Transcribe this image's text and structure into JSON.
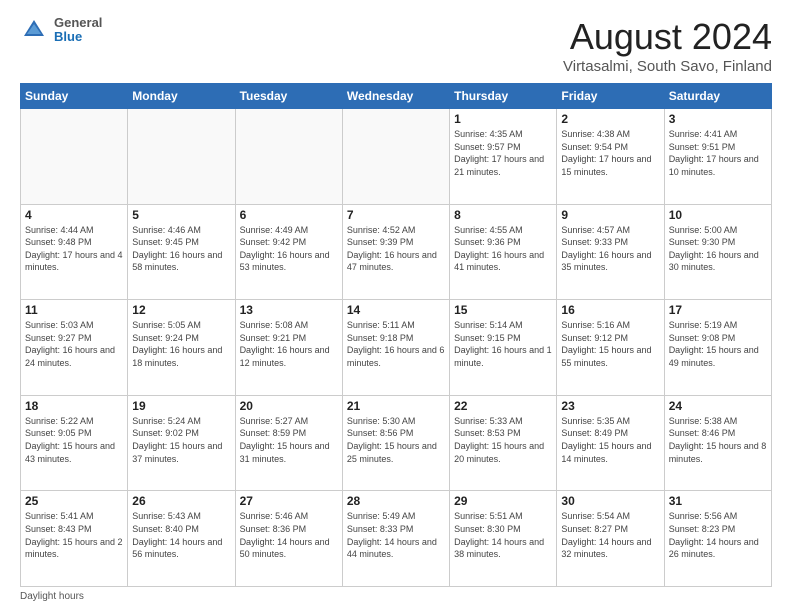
{
  "header": {
    "logo_line1": "General",
    "logo_line2": "Blue",
    "title": "August 2024",
    "subtitle": "Virtasalmi, South Savo, Finland"
  },
  "calendar": {
    "days_of_week": [
      "Sunday",
      "Monday",
      "Tuesday",
      "Wednesday",
      "Thursday",
      "Friday",
      "Saturday"
    ],
    "weeks": [
      [
        {
          "day": "",
          "info": ""
        },
        {
          "day": "",
          "info": ""
        },
        {
          "day": "",
          "info": ""
        },
        {
          "day": "",
          "info": ""
        },
        {
          "day": "1",
          "info": "Sunrise: 4:35 AM\nSunset: 9:57 PM\nDaylight: 17 hours\nand 21 minutes."
        },
        {
          "day": "2",
          "info": "Sunrise: 4:38 AM\nSunset: 9:54 PM\nDaylight: 17 hours\nand 15 minutes."
        },
        {
          "day": "3",
          "info": "Sunrise: 4:41 AM\nSunset: 9:51 PM\nDaylight: 17 hours\nand 10 minutes."
        }
      ],
      [
        {
          "day": "4",
          "info": "Sunrise: 4:44 AM\nSunset: 9:48 PM\nDaylight: 17 hours\nand 4 minutes."
        },
        {
          "day": "5",
          "info": "Sunrise: 4:46 AM\nSunset: 9:45 PM\nDaylight: 16 hours\nand 58 minutes."
        },
        {
          "day": "6",
          "info": "Sunrise: 4:49 AM\nSunset: 9:42 PM\nDaylight: 16 hours\nand 53 minutes."
        },
        {
          "day": "7",
          "info": "Sunrise: 4:52 AM\nSunset: 9:39 PM\nDaylight: 16 hours\nand 47 minutes."
        },
        {
          "day": "8",
          "info": "Sunrise: 4:55 AM\nSunset: 9:36 PM\nDaylight: 16 hours\nand 41 minutes."
        },
        {
          "day": "9",
          "info": "Sunrise: 4:57 AM\nSunset: 9:33 PM\nDaylight: 16 hours\nand 35 minutes."
        },
        {
          "day": "10",
          "info": "Sunrise: 5:00 AM\nSunset: 9:30 PM\nDaylight: 16 hours\nand 30 minutes."
        }
      ],
      [
        {
          "day": "11",
          "info": "Sunrise: 5:03 AM\nSunset: 9:27 PM\nDaylight: 16 hours\nand 24 minutes."
        },
        {
          "day": "12",
          "info": "Sunrise: 5:05 AM\nSunset: 9:24 PM\nDaylight: 16 hours\nand 18 minutes."
        },
        {
          "day": "13",
          "info": "Sunrise: 5:08 AM\nSunset: 9:21 PM\nDaylight: 16 hours\nand 12 minutes."
        },
        {
          "day": "14",
          "info": "Sunrise: 5:11 AM\nSunset: 9:18 PM\nDaylight: 16 hours\nand 6 minutes."
        },
        {
          "day": "15",
          "info": "Sunrise: 5:14 AM\nSunset: 9:15 PM\nDaylight: 16 hours\nand 1 minute."
        },
        {
          "day": "16",
          "info": "Sunrise: 5:16 AM\nSunset: 9:12 PM\nDaylight: 15 hours\nand 55 minutes."
        },
        {
          "day": "17",
          "info": "Sunrise: 5:19 AM\nSunset: 9:08 PM\nDaylight: 15 hours\nand 49 minutes."
        }
      ],
      [
        {
          "day": "18",
          "info": "Sunrise: 5:22 AM\nSunset: 9:05 PM\nDaylight: 15 hours\nand 43 minutes."
        },
        {
          "day": "19",
          "info": "Sunrise: 5:24 AM\nSunset: 9:02 PM\nDaylight: 15 hours\nand 37 minutes."
        },
        {
          "day": "20",
          "info": "Sunrise: 5:27 AM\nSunset: 8:59 PM\nDaylight: 15 hours\nand 31 minutes."
        },
        {
          "day": "21",
          "info": "Sunrise: 5:30 AM\nSunset: 8:56 PM\nDaylight: 15 hours\nand 25 minutes."
        },
        {
          "day": "22",
          "info": "Sunrise: 5:33 AM\nSunset: 8:53 PM\nDaylight: 15 hours\nand 20 minutes."
        },
        {
          "day": "23",
          "info": "Sunrise: 5:35 AM\nSunset: 8:49 PM\nDaylight: 15 hours\nand 14 minutes."
        },
        {
          "day": "24",
          "info": "Sunrise: 5:38 AM\nSunset: 8:46 PM\nDaylight: 15 hours\nand 8 minutes."
        }
      ],
      [
        {
          "day": "25",
          "info": "Sunrise: 5:41 AM\nSunset: 8:43 PM\nDaylight: 15 hours\nand 2 minutes."
        },
        {
          "day": "26",
          "info": "Sunrise: 5:43 AM\nSunset: 8:40 PM\nDaylight: 14 hours\nand 56 minutes."
        },
        {
          "day": "27",
          "info": "Sunrise: 5:46 AM\nSunset: 8:36 PM\nDaylight: 14 hours\nand 50 minutes."
        },
        {
          "day": "28",
          "info": "Sunrise: 5:49 AM\nSunset: 8:33 PM\nDaylight: 14 hours\nand 44 minutes."
        },
        {
          "day": "29",
          "info": "Sunrise: 5:51 AM\nSunset: 8:30 PM\nDaylight: 14 hours\nand 38 minutes."
        },
        {
          "day": "30",
          "info": "Sunrise: 5:54 AM\nSunset: 8:27 PM\nDaylight: 14 hours\nand 32 minutes."
        },
        {
          "day": "31",
          "info": "Sunrise: 5:56 AM\nSunset: 8:23 PM\nDaylight: 14 hours\nand 26 minutes."
        }
      ]
    ]
  },
  "footer": {
    "daylight_hours_label": "Daylight hours"
  }
}
